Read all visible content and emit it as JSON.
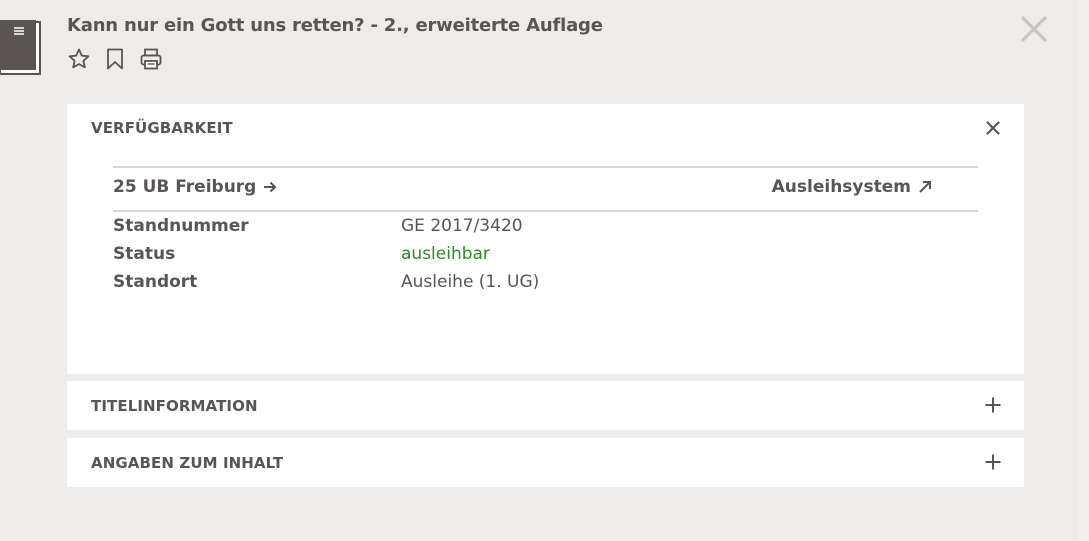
{
  "record": {
    "title": "Kann nur ein Gott uns retten? - 2., erweiterte Auflage"
  },
  "actions": {
    "icons": [
      "star-icon",
      "bookmark-icon",
      "print-icon"
    ]
  },
  "close": {
    "icon": "close-icon"
  },
  "availability": {
    "heading": "VERFÜGBARKEIT",
    "toggle_icon": "close-icon",
    "library": "25 UB Freiburg",
    "library_icon": "arrow-right-icon",
    "loan_system": "Ausleihsystem",
    "loan_system_icon": "arrow-up-right-icon",
    "rows": [
      {
        "label": "Standnummer",
        "value": "GE 2017/3420"
      },
      {
        "label": "Status",
        "value": "ausleihbar",
        "color": "#2e8a22"
      },
      {
        "label": "Standort",
        "value": "Ausleihe (1. UG)"
      }
    ]
  },
  "sections": [
    {
      "heading": "TITELINFORMATION",
      "toggle_icon": "plus-icon"
    },
    {
      "heading": "ANGABEN ZUM INHALT",
      "toggle_icon": "plus-icon"
    }
  ],
  "colors": {
    "background": "#edeceb",
    "panel": "#ffffff",
    "text": "#5a5552",
    "status_ok": "#2e8a22"
  }
}
